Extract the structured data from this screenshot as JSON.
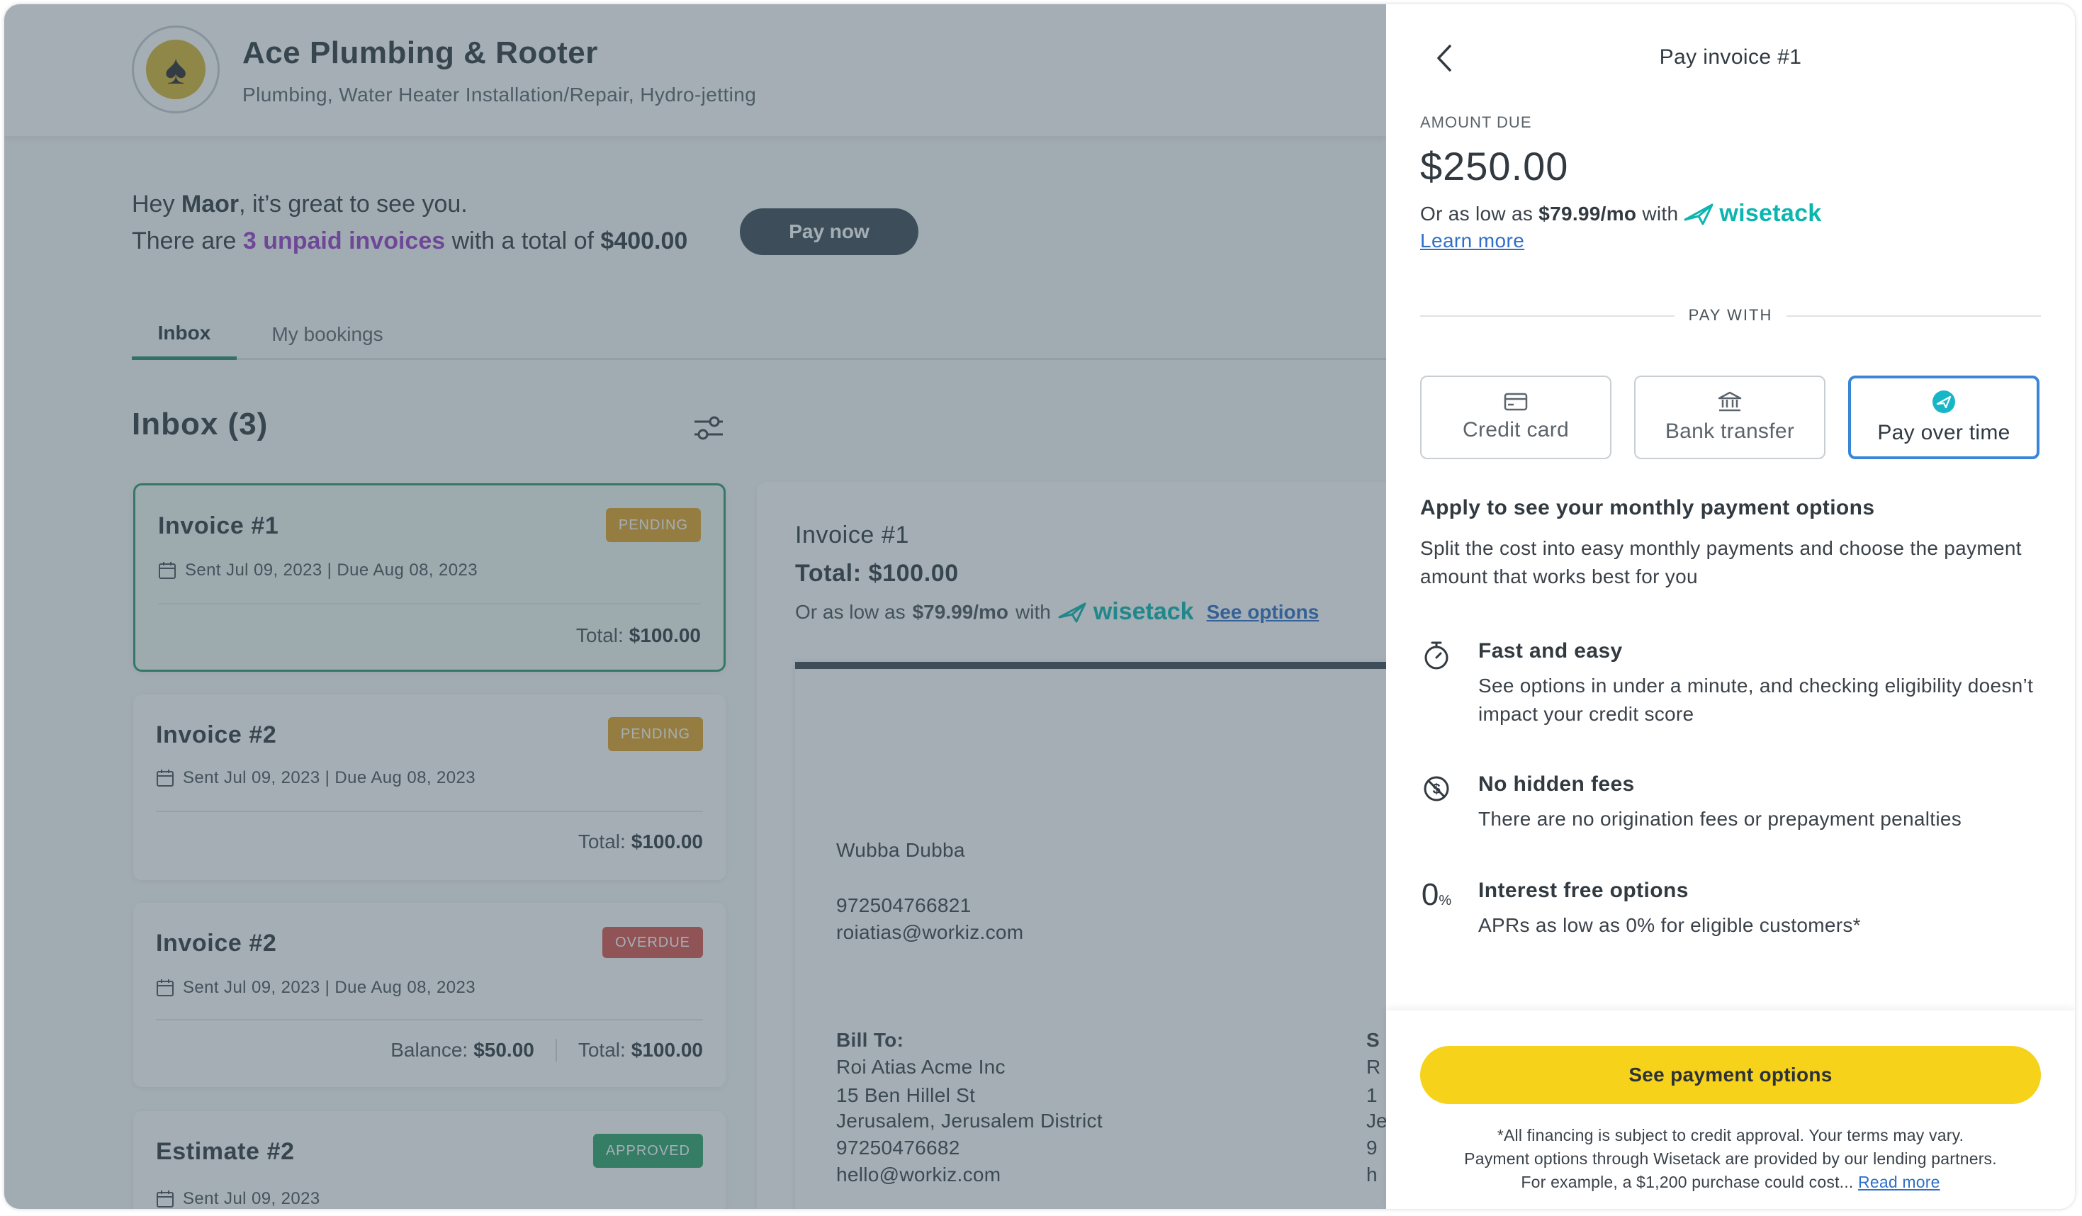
{
  "business": {
    "name": "Ace Plumbing & Rooter",
    "services": "Plumbing, Water Heater Installation/Repair, Hydro-jetting"
  },
  "greeting": {
    "hey": "Hey ",
    "name": "Maor",
    "rest": ", it’s great to see you.",
    "there_are": "There are ",
    "unpaid": "3 unpaid invoices",
    "with_total": " with a total of ",
    "total": "$400.00",
    "pay_now": "Pay now"
  },
  "tabs": {
    "inbox": "Inbox",
    "bookings": "My bookings"
  },
  "inbox": {
    "title": "Inbox (3)",
    "cards": [
      {
        "title": "Invoice #1",
        "badge": "PENDING",
        "dates": "Sent Jul 09, 2023 | Due Aug 08, 2023",
        "total_label": "Total:",
        "total": "$100.00"
      },
      {
        "title": "Invoice #2",
        "badge": "PENDING",
        "dates": "Sent Jul 09, 2023 | Due Aug 08, 2023",
        "total_label": "Total:",
        "total": "$100.00"
      },
      {
        "title": "Invoice #2",
        "badge": "OVERDUE",
        "dates": "Sent Jul 09, 2023 | Due Aug 08, 2023",
        "balance_label": "Balance:",
        "balance": "$50.00",
        "total_label": "Total:",
        "total": "$100.00"
      },
      {
        "title": "Estimate #2",
        "badge": "APPROVED",
        "dates": "Sent Jul 09, 2023"
      }
    ]
  },
  "preview": {
    "title": "Invoice #1",
    "total": "Total: $100.00",
    "lowas_prefix": "Or as low as",
    "lowas_amount": "$79.99/mo",
    "lowas_with": "with",
    "brand": "wisetack",
    "see_options": "See options",
    "doc": {
      "company": "Wubba Dubba",
      "phone": "972504766821",
      "email": "roiatias@workiz.com",
      "bill_to_label": "Bill To:",
      "bill_to_name": "Roi Atias Acme Inc",
      "bill_to_street": "15 Ben Hillel St",
      "bill_to_city": "Jerusalem, Jerusalem District",
      "bill_to_phone": "97250476682",
      "bill_to_email": "hello@workiz.com",
      "col2": [
        "S",
        "R",
        "1",
        "Je",
        "9",
        "h"
      ]
    }
  },
  "panel": {
    "title": "Pay invoice #1",
    "amount_label": "AMOUNT DUE",
    "amount": "$250.00",
    "lowas_prefix": "Or as low as",
    "lowas_amount": "$79.99/mo",
    "lowas_with": "with",
    "brand": "wisetack",
    "learn_more": "Learn more",
    "pay_with": "PAY WITH",
    "methods": [
      {
        "label": "Credit card",
        "icon": "credit-card-icon"
      },
      {
        "label": "Bank transfer",
        "icon": "bank-icon"
      },
      {
        "label": "Pay over time",
        "icon": "wisetack-icon",
        "active": true
      }
    ],
    "apply_title": "Apply to see your monthly payment options",
    "apply_desc": "Split the cost into easy monthly payments and choose the payment amount that works best for you",
    "features": [
      {
        "icon": "stopwatch-icon",
        "title": "Fast and easy",
        "desc": "See options in under a minute, and checking eligibility doesn’t impact your credit score"
      },
      {
        "icon": "no-fees-icon",
        "title": "No hidden fees",
        "desc": "There are no origination fees or prepayment penalties"
      },
      {
        "icon": "zero-percent-icon",
        "icon_text": "0",
        "icon_sub": "%",
        "title": "Interest free options",
        "desc": "APRs as low as 0% for eligible customers*"
      }
    ],
    "cta": "See payment options",
    "disclaimer_1": "*All financing is subject to credit approval. Your terms may vary.",
    "disclaimer_2": "Payment options through Wisetack are provided by our lending partners.",
    "disclaimer_3": "For example, a $1,200 purchase could cost...",
    "read_more": "Read more"
  },
  "colors": {
    "accent_green": "#2a9a70",
    "badge_pending": "#e3a228",
    "badge_overdue": "#d9534f",
    "badge_approved": "#2fa36b",
    "wisetack": "#0bb5b0",
    "cta_yellow": "#f6d21a",
    "active_method_border": "#3a86d6",
    "overlay": "#3e5260"
  }
}
